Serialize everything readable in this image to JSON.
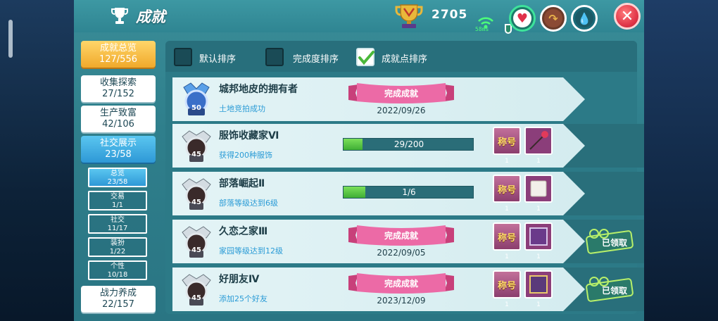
{
  "header": {
    "title": "成就",
    "points": "2705",
    "ping": "58ms"
  },
  "sidebar": {
    "main_items": [
      {
        "label": "成就总览",
        "count": "127/556"
      },
      {
        "label": "收集探索",
        "count": "27/152"
      },
      {
        "label": "生产致富",
        "count": "42/106"
      },
      {
        "label": "社交展示",
        "count": "23/58"
      },
      {
        "label": "战力养成",
        "count": "22/157"
      }
    ],
    "sub_items": [
      {
        "label": "总览",
        "count": "23/58"
      },
      {
        "label": "交易",
        "count": "1/1"
      },
      {
        "label": "社交",
        "count": "11/17"
      },
      {
        "label": "装扮",
        "count": "1/22"
      },
      {
        "label": "个性",
        "count": "10/18"
      }
    ]
  },
  "sort": {
    "default": "默认排序",
    "completion": "完成度排序",
    "points": "成就点排序"
  },
  "achievements": [
    {
      "name": "城邦地皮的拥有者",
      "desc": "土地竞拍成功",
      "medal": "50",
      "status": "完成成就",
      "date": "2022/09/26"
    },
    {
      "name": "服饰收藏家Ⅵ",
      "desc": "获得200种服饰",
      "medal": "45",
      "progress_text": "29/200",
      "progress_fraction": 0.145,
      "reward_title": "称号",
      "reward_counts": [
        "1",
        "1"
      ]
    },
    {
      "name": "部落崛起Ⅱ",
      "desc": "部落等级达到6级",
      "medal": "45",
      "progress_text": "1/6",
      "progress_fraction": 0.1667,
      "reward_title": "称号",
      "reward_counts": [
        "1",
        "1"
      ]
    },
    {
      "name": "久恋之家Ⅲ",
      "desc": "家园等级达到12级",
      "medal": "45",
      "status": "完成成就",
      "date": "2022/09/05",
      "reward_title": "称号",
      "reward_counts": [
        "1",
        "1"
      ],
      "claimed": "已领取"
    },
    {
      "name": "好朋友Ⅳ",
      "desc": "添加25个好友",
      "medal": "45",
      "status": "完成成就",
      "date": "2023/12/09",
      "reward_title": "称号",
      "reward_counts": [
        "1",
        "1"
      ],
      "claimed": "已领取"
    }
  ],
  "colors": {
    "panel": "#2f7f8c",
    "gold": "#f0a92b",
    "active_blue": "#2e98d6",
    "ribbon": "#e85a9a",
    "progress": "#3fae35",
    "close": "#e2384a"
  }
}
